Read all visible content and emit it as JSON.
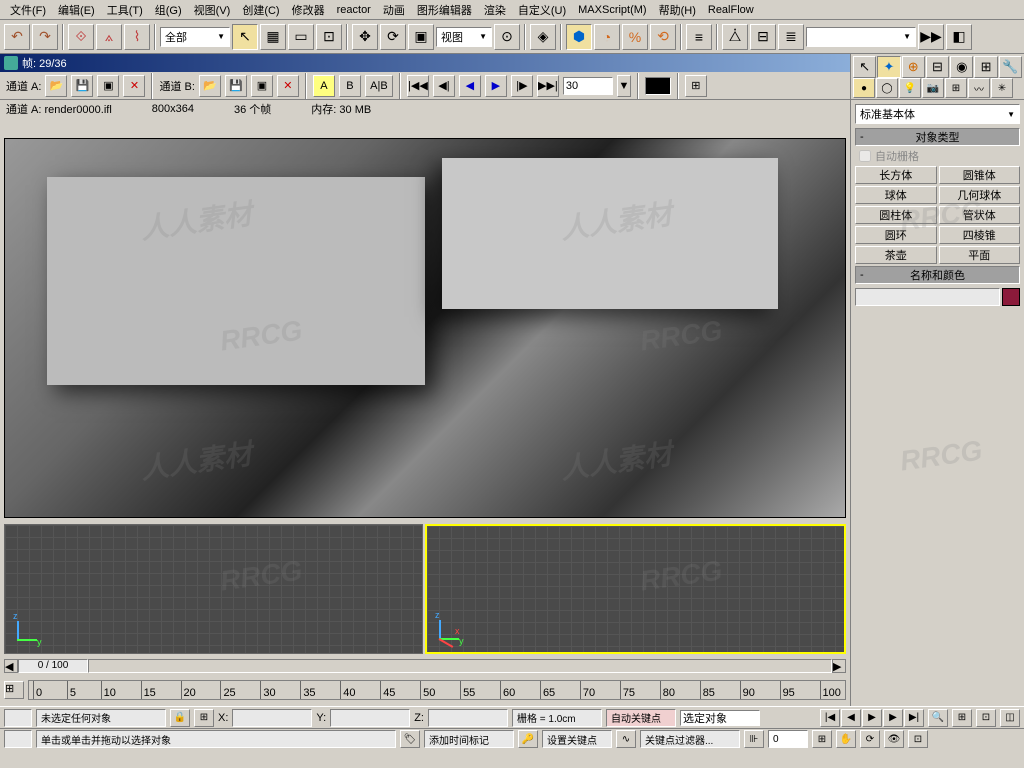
{
  "menu": {
    "file": "文件(F)",
    "edit": "编辑(E)",
    "tools": "工具(T)",
    "group": "组(G)",
    "views": "视图(V)",
    "create": "创建(C)",
    "modifiers": "修改器",
    "reactor": "reactor",
    "animation": "动画",
    "graph": "图形编辑器",
    "rendering": "渲染",
    "customize": "自定义(U)",
    "maxscript": "MAXScript(M)",
    "help": "帮助(H)",
    "realflow": "RealFlow"
  },
  "toolbar": {
    "selection_filter": "全部",
    "ref_coord": "视图"
  },
  "render_window": {
    "title": "帧: 29/36"
  },
  "channel": {
    "a_label": "通道 A:",
    "b_label": "通道 B:",
    "alpha": "A",
    "b": "B",
    "ab": "A|B",
    "frame_value": "30"
  },
  "info": {
    "file": "通道 A: render0000.ifl",
    "resolution": "800x364",
    "frames": "36 个帧",
    "memory": "内存: 30 MB"
  },
  "timeline": {
    "current": "0 / 100",
    "ticks": [
      "0",
      "5",
      "10",
      "15",
      "20",
      "25",
      "30",
      "35",
      "40",
      "45",
      "50",
      "55",
      "60",
      "65",
      "70",
      "75",
      "80",
      "85",
      "90",
      "95",
      "100"
    ]
  },
  "command_panel": {
    "category": "标准基本体",
    "rollout_type": "对象类型",
    "autogrid": "自动栅格",
    "primitives": [
      [
        "长方体",
        "圆锥体"
      ],
      [
        "球体",
        "几何球体"
      ],
      [
        "圆柱体",
        "管状体"
      ],
      [
        "圆环",
        "四棱锥"
      ],
      [
        "茶壶",
        "平面"
      ]
    ],
    "rollout_name": "名称和颜色"
  },
  "status": {
    "no_selection": "未选定任何对象",
    "prompt": "单击或单击并拖动以选择对象",
    "x": "X:",
    "y": "Y:",
    "z": "Z:",
    "grid": "栅格 = 1.0cm",
    "add_time": "添加时间标记",
    "auto_key": "自动关键点",
    "set_key": "设置关键点",
    "selected": "选定对象",
    "key_filter": "关键点过滤器...",
    "frame_field": "0"
  },
  "watermarks": [
    "人人素材",
    "RRCG"
  ]
}
